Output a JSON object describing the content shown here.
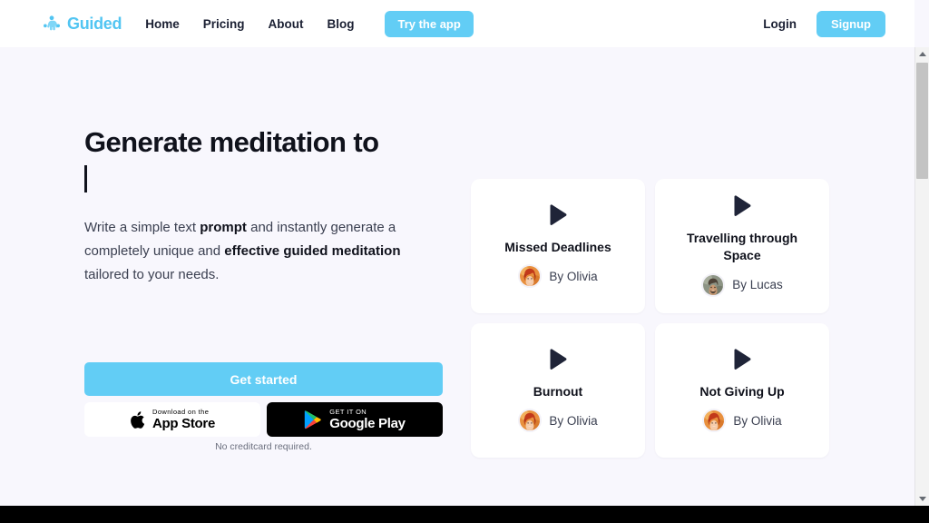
{
  "header": {
    "brand": {
      "name": "Guided",
      "icon": "meditation-figure-icon",
      "color": "#52c5f2"
    },
    "nav": [
      {
        "label": "Home"
      },
      {
        "label": "Pricing"
      },
      {
        "label": "About"
      },
      {
        "label": "Blog"
      }
    ],
    "try_app_label": "Try the app",
    "login_label": "Login",
    "signup_label": "Signup",
    "accent_color": "#62cdf5"
  },
  "hero": {
    "title_line1": "Generate meditation to",
    "title_line2": "",
    "caret": "text-cursor",
    "paragraph": {
      "part1": "Write a simple text ",
      "bold1": "prompt",
      "part2": " and instantly generate a completely unique and ",
      "bold2": "effective guided meditation",
      "part3": " tailored to your needs."
    },
    "cta_label": "Get started",
    "store_badges": [
      {
        "small": "Download on the",
        "big": "App Store",
        "icon": "apple-icon",
        "theme": "light"
      },
      {
        "small": "GET IT ON",
        "big": "Google Play",
        "icon": "google-play-icon",
        "theme": "dark"
      }
    ],
    "note": "No creditcard required."
  },
  "cards": [
    {
      "title": "Missed Deadlines",
      "author": "By Olivia",
      "avatar": "olivia",
      "icon": "play-icon"
    },
    {
      "title": "Travelling through Space",
      "author": "By Lucas",
      "avatar": "lucas",
      "icon": "play-icon"
    },
    {
      "title": "Burnout",
      "author": "By Olivia",
      "avatar": "olivia",
      "icon": "play-icon"
    },
    {
      "title": "Not Giving Up",
      "author": "By Olivia",
      "avatar": "olivia",
      "icon": "play-icon"
    }
  ],
  "scrollbar": {
    "up": "scroll-up-arrow",
    "down": "scroll-down-arrow",
    "thumb": "scroll-thumb"
  },
  "colors": {
    "page_background": "#f8f7fd",
    "header_background": "#ffffff",
    "accent": "#62cdf5",
    "text_dark": "#10121c",
    "play_icon": "#1f2438"
  }
}
